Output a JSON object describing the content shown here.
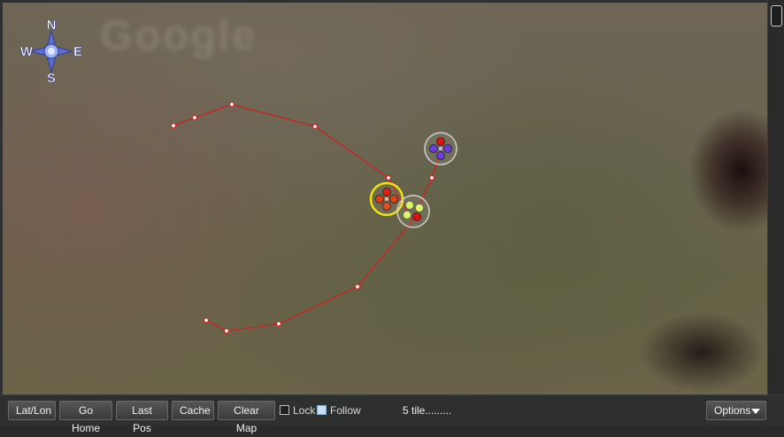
{
  "compass": {
    "north": "N",
    "south": "S",
    "east": "E",
    "west": "W"
  },
  "map": {
    "watermark_text": "Google",
    "route_color": "#cc2222",
    "selected_ring_color": "#f2e20c",
    "waypoint_ring_color": "#d0d0d0"
  },
  "toolbar": {
    "buttons": [
      "Lat/Lon",
      "Go Home",
      "Last Pos",
      "Cache",
      "Clear Map"
    ],
    "lock_label": "Lock",
    "follow_label": "Follow",
    "status_text": "5 tile.........",
    "options_label": "Options"
  }
}
